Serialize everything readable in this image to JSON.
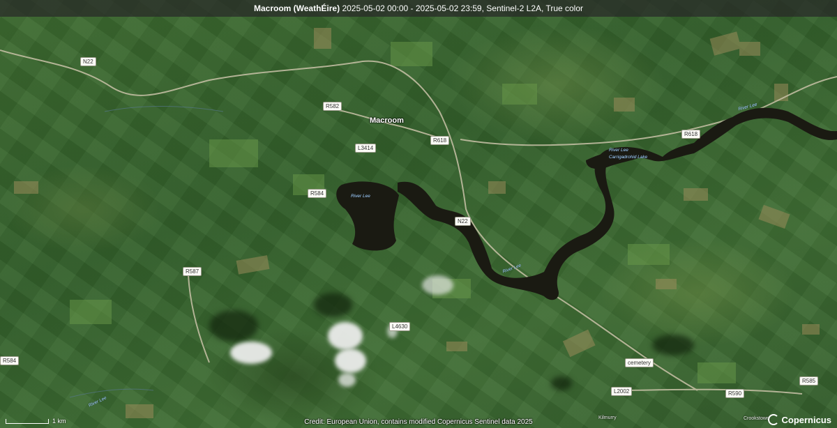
{
  "title": {
    "place": "Macroom (WeathÉire)",
    "details": "2025-05-02 00:00 - 2025-05-02 23:59, Sentinel-2 L2A, True color"
  },
  "places": {
    "macroom": "Macroom",
    "kilmurry": "Kilmurry",
    "crookstown": "Crookstown",
    "cemetery": "cemetery"
  },
  "water": {
    "river_lee_1": "River Lee",
    "river_lee_2": "River Lee",
    "river_lee_3": "River Lee",
    "river_lee_4": "River Lee",
    "river_lee_5": "River Lee",
    "reservoir": "Carrigadrohid Lake"
  },
  "roads": {
    "n22_west": "N22",
    "n22_center": "N22",
    "r582": "R582",
    "r618_center": "R618",
    "r618_east": "R618",
    "l3414": "L3414",
    "r584_center": "R584",
    "r584_west": "R584",
    "r587": "R587",
    "l4630": "L4630",
    "l2002": "L2002",
    "r590": "R590",
    "r585": "R585"
  },
  "scale": {
    "label": "1 km"
  },
  "credit": "Credit: European Union, contains modified Copernicus Sentinel data 2025",
  "logo": {
    "text": "Copernicus"
  },
  "colors": {
    "water": "#1a1a12",
    "river_label": "#aad4ff",
    "road": "#c9c2a8",
    "title_bg": "#282828"
  }
}
